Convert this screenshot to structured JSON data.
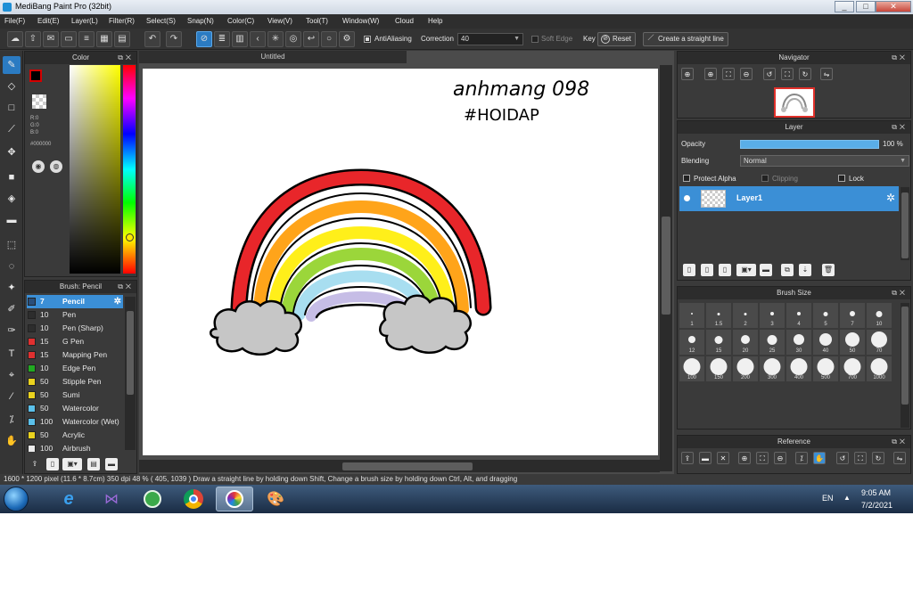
{
  "window": {
    "title": "MediBang Paint Pro (32bit)",
    "min": "_",
    "max": "□",
    "close": "✕"
  },
  "menu": [
    "File(F)",
    "Edit(E)",
    "Layer(L)",
    "Filter(R)",
    "Select(S)",
    "Snap(N)",
    "Color(C)",
    "View(V)",
    "Tool(T)",
    "Window(W)",
    "Cloud",
    "Help"
  ],
  "toolbar": {
    "antialiasing": "AntiAliasing",
    "correction_label": "Correction",
    "correction_value": "40",
    "soft_edge": "Soft Edge",
    "key_label": "Key",
    "reset": "Reset",
    "straight_line": "Create a straight line"
  },
  "color_panel": {
    "title": "Color",
    "r": "R:0",
    "g": "G:0",
    "b": "B:0",
    "hex": "#000000",
    "fg_color": "#000000",
    "accent": "#d40000"
  },
  "brush_panel": {
    "title": "Brush: Pencil",
    "items": [
      {
        "size": "7",
        "name": "Pencil",
        "color": "#2a4f7a"
      },
      {
        "size": "10",
        "name": "Pen",
        "color": "#2d2d2d"
      },
      {
        "size": "10",
        "name": "Pen (Sharp)",
        "color": "#2d2d2d"
      },
      {
        "size": "15",
        "name": "G Pen",
        "color": "#e03030"
      },
      {
        "size": "15",
        "name": "Mapping Pen",
        "color": "#e03030"
      },
      {
        "size": "10",
        "name": "Edge Pen",
        "color": "#22aa22"
      },
      {
        "size": "50",
        "name": "Stipple Pen",
        "color": "#ead21e"
      },
      {
        "size": "50",
        "name": "Sumi",
        "color": "#ead21e"
      },
      {
        "size": "50",
        "name": "Watercolor",
        "color": "#5bc0ea"
      },
      {
        "size": "100",
        "name": "Watercolor (Wet)",
        "color": "#5bc0ea"
      },
      {
        "size": "50",
        "name": "Acrylic",
        "color": "#ead21e"
      },
      {
        "size": "100",
        "name": "Airbrush",
        "color": "#eaeaea"
      }
    ]
  },
  "canvas": {
    "tab": "Untitled",
    "handwriting_line1": "anhmang 098",
    "handwriting_line2": "#HOIDAP"
  },
  "navigator": {
    "title": "Navigator"
  },
  "layer_panel": {
    "title": "Layer",
    "opacity_label": "Opacity",
    "opacity_value": "100 %",
    "opacity_fraction": 1.0,
    "blending_label": "Blending",
    "blending_value": "Normal",
    "protect_alpha": "Protect Alpha",
    "clipping": "Clipping",
    "lock": "Lock",
    "layer_name": "Layer1"
  },
  "brush_size": {
    "title": "Brush Size",
    "sizes": [
      "1",
      "1.5",
      "2",
      "3",
      "4",
      "5",
      "7",
      "10",
      "12",
      "15",
      "20",
      "25",
      "30",
      "40",
      "50",
      "70",
      "100",
      "150",
      "200",
      "300",
      "400",
      "500",
      "700",
      "1000"
    ]
  },
  "reference": {
    "title": "Reference"
  },
  "status": {
    "text": "1600 * 1200 pixel  (11.6 * 8.7cm)  350 dpi  48 %  ( 405, 1039 )  Draw a straight line by holding down Shift, Change a brush size by holding down Ctrl, Alt, and dragging"
  },
  "taskbar": {
    "lang": "EN",
    "time": "9:05 AM",
    "date": "7/2/2021"
  }
}
